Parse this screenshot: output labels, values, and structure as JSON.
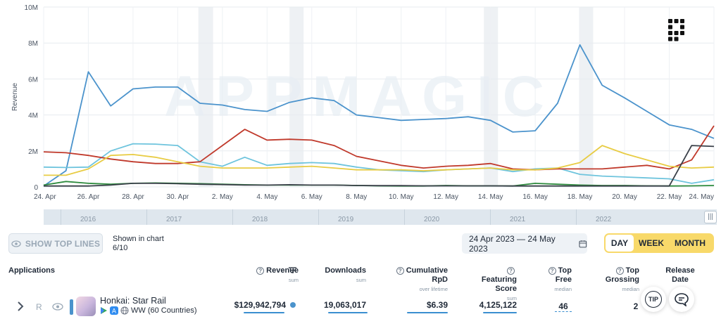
{
  "chart_data": {
    "type": "line",
    "ylabel": "Revenue",
    "ylim": [
      0,
      10000000
    ],
    "y_ticks": [
      "0",
      "2M",
      "4M",
      "6M",
      "8M",
      "10M"
    ],
    "y_tick_values": [
      0,
      2000000,
      4000000,
      6000000,
      8000000,
      10000000
    ],
    "x_ticks": [
      "24. Apr",
      "26. Apr",
      "28. Apr",
      "30. Apr",
      "2. May",
      "4. May",
      "6. May",
      "8. May",
      "10. May",
      "12. May",
      "14. May",
      "16. May",
      "18. May",
      "20. May",
      "22. May",
      "24. May"
    ],
    "x_count": 31,
    "watermark": "APPMAGIC",
    "grid": true,
    "series": [
      {
        "color": "#4b93cc",
        "values": [
          50000,
          900000,
          6400000,
          4500000,
          5450000,
          5550000,
          5550000,
          4650000,
          4550000,
          4300000,
          4200000,
          4700000,
          4950000,
          4800000,
          4000000,
          3850000,
          3700000,
          3750000,
          3800000,
          3900000,
          3700000,
          3050000,
          3120000,
          4650000,
          7900000,
          5650000,
          4950000,
          4200000,
          3450000,
          3200000,
          2700000
        ]
      },
      {
        "color": "#6ec4dd",
        "values": [
          1100000,
          1080000,
          1100000,
          2000000,
          2400000,
          2380000,
          2300000,
          1400000,
          1150000,
          1650000,
          1200000,
          1300000,
          1350000,
          1300000,
          1100000,
          950000,
          900000,
          850000,
          950000,
          1000000,
          1050000,
          850000,
          1000000,
          1050000,
          700000,
          600000,
          550000,
          500000,
          450000,
          200000,
          400000
        ]
      },
      {
        "color": "#c0392b",
        "values": [
          1950000,
          1900000,
          1750000,
          1550000,
          1400000,
          1300000,
          1300000,
          1400000,
          2300000,
          3200000,
          2600000,
          2650000,
          2600000,
          2300000,
          1700000,
          1450000,
          1200000,
          1050000,
          1150000,
          1200000,
          1300000,
          1000000,
          950000,
          1000000,
          1000000,
          1000000,
          1100000,
          1200000,
          1000000,
          1500000,
          3400000
        ]
      },
      {
        "color": "#e8cc44",
        "values": [
          650000,
          650000,
          1000000,
          1750000,
          1800000,
          1650000,
          1400000,
          1150000,
          1050000,
          1050000,
          1050000,
          1100000,
          1150000,
          1050000,
          950000,
          950000,
          950000,
          900000,
          950000,
          1000000,
          1050000,
          950000,
          950000,
          1050000,
          1350000,
          2300000,
          1850000,
          1500000,
          1150000,
          1050000,
          1100000
        ]
      },
      {
        "color": "#2e8b3e",
        "values": [
          100000,
          300000,
          200000,
          150000,
          200000,
          220000,
          200000,
          180000,
          150000,
          120000,
          100000,
          100000,
          100000,
          100000,
          80000,
          60000,
          50000,
          50000,
          80000,
          60000,
          60000,
          50000,
          200000,
          150000,
          100000,
          80000,
          80000,
          60000,
          50000,
          60000,
          80000
        ]
      },
      {
        "color": "#3a4049",
        "values": [
          50000,
          50000,
          50000,
          100000,
          200000,
          200000,
          180000,
          150000,
          130000,
          100000,
          100000,
          120000,
          100000,
          100000,
          80000,
          70000,
          70000,
          60000,
          60000,
          60000,
          60000,
          50000,
          50000,
          50000,
          50000,
          50000,
          50000,
          50000,
          50000,
          2300000,
          2250000
        ]
      }
    ]
  },
  "timeline": {
    "years": [
      "2016",
      "2017",
      "2018",
      "2019",
      "2020",
      "2021",
      "2022"
    ],
    "grip": "|||"
  },
  "toolbar": {
    "show_top_lines": "SHOW TOP LINES",
    "shown_in_chart_label": "Shown in chart",
    "shown_in_chart_value": "6/10",
    "date_range": "24 Apr 2023 — 24 May 2023",
    "periods": [
      "DAY",
      "WEEK",
      "MONTH"
    ],
    "active_period": "DAY",
    "period_color": "#f8d96a"
  },
  "table": {
    "columns": {
      "applications": "Applications",
      "revenue": "Revenue",
      "revenue_sub": "sum",
      "downloads": "Downloads",
      "downloads_sub": "sum",
      "rpd": "Cumulative RpD",
      "rpd_sub": "over lifetime",
      "featuring": "Featuring",
      "featuring_2": "Score",
      "featuring_sub": "sum",
      "top_free": "Top",
      "top_free_2": "Free",
      "top_free_sub": "median",
      "top_grossing": "Top",
      "top_grossing_2": "Grossing",
      "top_grossing_sub": "median",
      "release": "Release",
      "release_2": "Date"
    },
    "rows": [
      {
        "rank_marker": "R",
        "name": "Honkai: Star Rail",
        "region": "WW (60 Countries)",
        "revenue": "$129,942,794",
        "downloads": "19,063,017",
        "rpd": "$6.39",
        "featuring": "4,125,122",
        "top_free": "46",
        "top_grossing": "2",
        "series_color": "#4b93cc"
      }
    ]
  },
  "floating": {
    "tip": "TIP"
  }
}
